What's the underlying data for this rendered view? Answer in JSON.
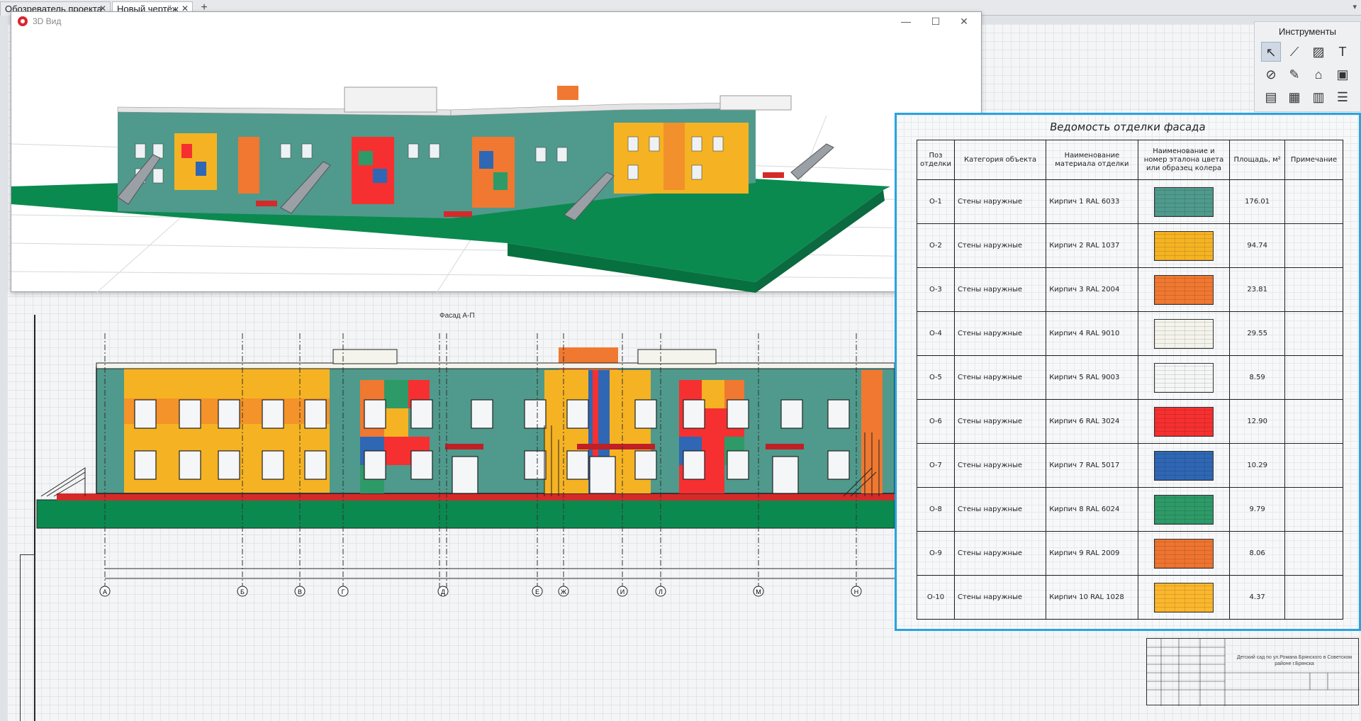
{
  "tabs": [
    {
      "label": "Обозреватель проекта",
      "active": false
    },
    {
      "label": "Новый чертёж",
      "active": true
    }
  ],
  "add_tab_label": "+",
  "view3d": {
    "title": "3D Вид",
    "minimize": "—",
    "maximize": "☐",
    "close": "✕"
  },
  "tools": {
    "title": "Инструменты",
    "items": [
      {
        "name": "select-tool-icon",
        "glyph": "↖"
      },
      {
        "name": "line-tool-icon",
        "glyph": "⟋"
      },
      {
        "name": "hatch-tool-icon",
        "glyph": "▨"
      },
      {
        "name": "text-tool-icon",
        "glyph": "T"
      },
      {
        "name": "dimension-tool-icon",
        "glyph": "⊘"
      },
      {
        "name": "edit-tool-icon",
        "glyph": "✎"
      },
      {
        "name": "building-tool-icon",
        "glyph": "⌂"
      },
      {
        "name": "box-tool-icon",
        "glyph": "▣"
      },
      {
        "name": "sheet-tool-icon",
        "glyph": "▤"
      },
      {
        "name": "table-tool-icon",
        "glyph": "▦"
      },
      {
        "name": "grid-tool-icon",
        "glyph": "▥"
      },
      {
        "name": "list-tool-icon",
        "glyph": "☰"
      }
    ]
  },
  "facade_label": "Фасад А-П",
  "axis_labels": [
    "А",
    "Б",
    "В",
    "Г",
    "Д",
    "Е",
    "Ж",
    "И",
    "Л",
    "М",
    "Н"
  ],
  "schedule": {
    "title": "Ведомость отделки фасада",
    "headers": [
      "Поз отделки",
      "Категория объекта",
      "Наименование материала отделки",
      "Наименование и номер эталона цвета или образец колера",
      "Площадь, м²",
      "Примечание"
    ],
    "rows": [
      {
        "pos": "О-1",
        "category": "Стены наружные",
        "material": "Кирпич 1 RAL 6033",
        "color": "#4f9a8c",
        "area": "176.01",
        "note": ""
      },
      {
        "pos": "О-2",
        "category": "Стены наружные",
        "material": "Кирпич 2 RAL 1037",
        "color": "#f5b323",
        "area": "94.74",
        "note": ""
      },
      {
        "pos": "О-3",
        "category": "Стены наружные",
        "material": "Кирпич 3 RAL 2004",
        "color": "#f07830",
        "area": "23.81",
        "note": ""
      },
      {
        "pos": "О-4",
        "category": "Стены наружные",
        "material": "Кирпич 4 RAL 9010",
        "color": "#f4f4ec",
        "area": "29.55",
        "note": ""
      },
      {
        "pos": "О-5",
        "category": "Стены наружные",
        "material": "Кирпич 5 RAL 9003",
        "color": "#f5f6f6",
        "area": "8.59",
        "note": ""
      },
      {
        "pos": "О-6",
        "category": "Стены наружные",
        "material": "Кирпич 6 RAL 3024",
        "color": "#f63030",
        "area": "12.90",
        "note": ""
      },
      {
        "pos": "О-7",
        "category": "Стены наружные",
        "material": "Кирпич 7 RAL 5017",
        "color": "#2f67b4",
        "area": "10.29",
        "note": ""
      },
      {
        "pos": "О-8",
        "category": "Стены наружные",
        "material": "Кирпич 8 RAL 6024",
        "color": "#2e9a68",
        "area": "9.79",
        "note": ""
      },
      {
        "pos": "О-9",
        "category": "Стены наружные",
        "material": "Кирпич 9 RAL 2009",
        "color": "#ee7430",
        "area": "8.06",
        "note": ""
      },
      {
        "pos": "О-10",
        "category": "Стены наружные",
        "material": "Кирпич 10 RAL 1028",
        "color": "#fbb72d",
        "area": "4.37",
        "note": ""
      }
    ]
  },
  "title_block": {
    "project": "Детский сад по ул.Романа Брянского в Советском районе г.Брянска"
  }
}
